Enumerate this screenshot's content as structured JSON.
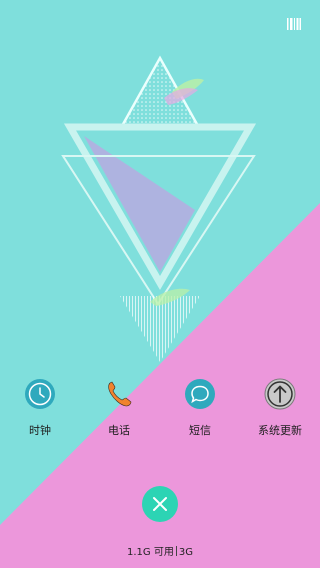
{
  "colors": {
    "teal": "#7fdfdc",
    "pink": "#ec97db",
    "accent": "#2cd4b4",
    "phone_orange": "#f0832e"
  },
  "apps": [
    {
      "label": "时钟",
      "icon": "clock-icon"
    },
    {
      "label": "电话",
      "icon": "phone-icon"
    },
    {
      "label": "短信",
      "icon": "message-icon"
    },
    {
      "label": "系统更新",
      "icon": "update-arrow-icon"
    }
  ],
  "close_button": {
    "icon": "close-icon"
  },
  "memory": {
    "available": "1.1G 可用",
    "network": "3G"
  },
  "corner": {
    "icon": "barcode-icon"
  }
}
